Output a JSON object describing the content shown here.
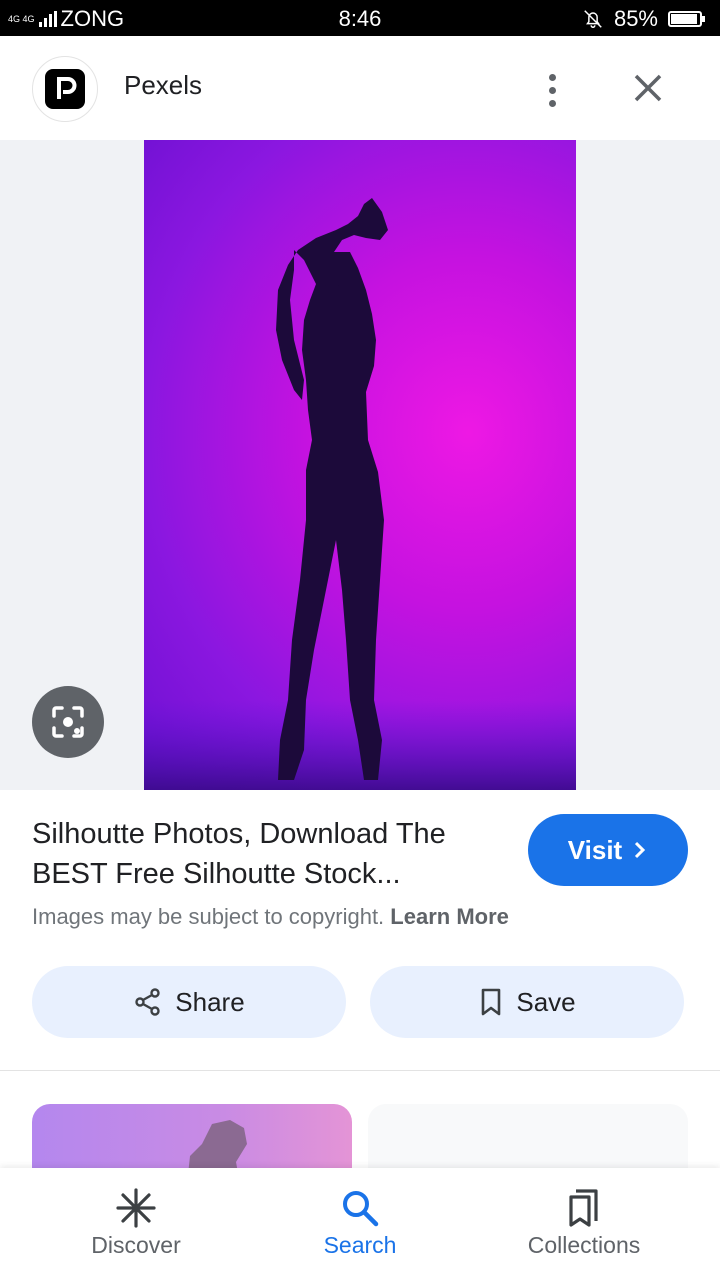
{
  "status_bar": {
    "network_top": "4G 4G",
    "carrier": "ZONG",
    "time": "8:46",
    "battery_text": "85%",
    "battery_level": 0.85
  },
  "header": {
    "site_name": "Pexels",
    "logo_icon": "pexels-logo-icon",
    "menu_icon": "more-vert-icon",
    "close_icon": "close-icon"
  },
  "result": {
    "title": "Silhoutte Photos, Download The BEST Free Silhoutte Stock...",
    "visit_label": "Visit",
    "copyright_text": "Images may be subject to copyright.",
    "learn_more": "Learn More",
    "share_label": "Share",
    "save_label": "Save"
  },
  "nav": {
    "items": [
      {
        "label": "Discover",
        "icon": "discover-asterisk-icon"
      },
      {
        "label": "Search",
        "icon": "search-icon"
      },
      {
        "label": "Collections",
        "icon": "collections-icon"
      }
    ],
    "active": "Search"
  },
  "colors": {
    "accent": "#1a73e8",
    "chip_bg": "#e8f0fe",
    "photo_purple": "#c512e0"
  }
}
